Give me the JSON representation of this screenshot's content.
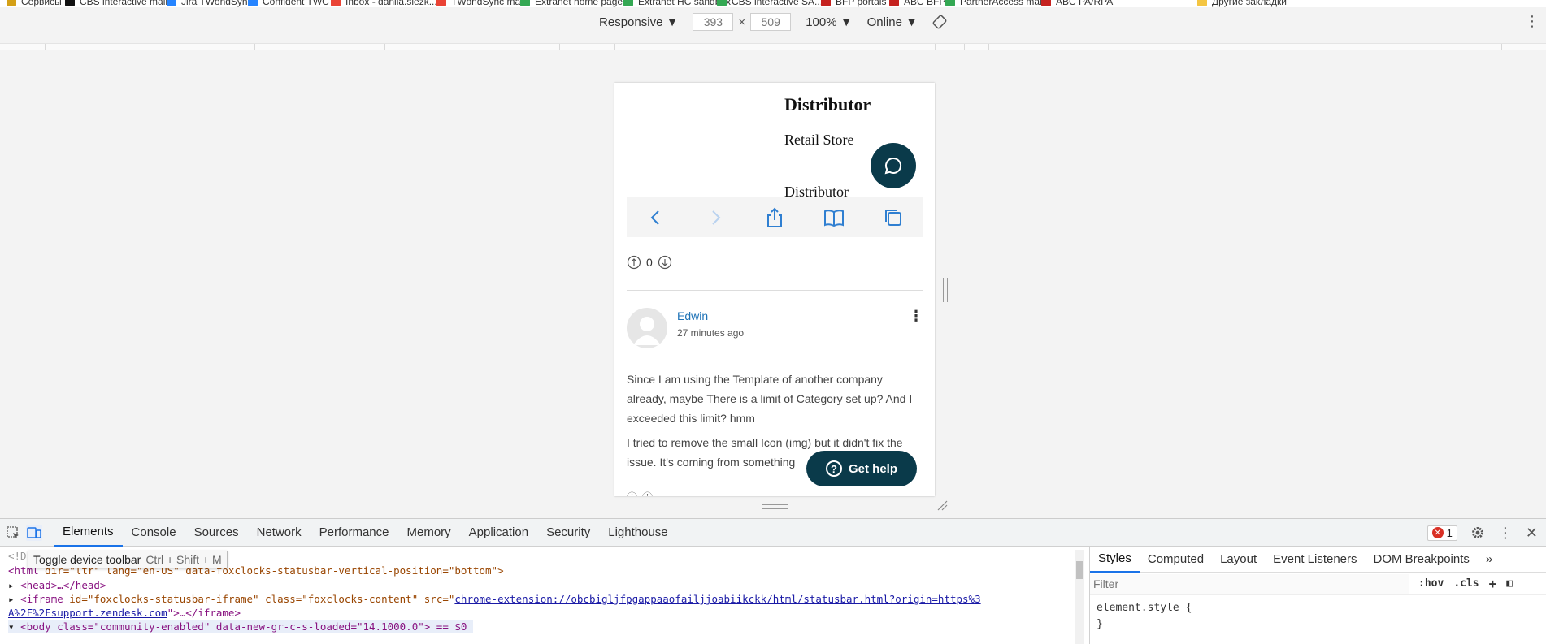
{
  "bookmarks": [
    {
      "label": "Сервисы",
      "color": "#d4a017"
    },
    {
      "label": "CBS interactive main",
      "color": "#111111"
    },
    {
      "label": "Jira TWondSync",
      "color": "#2684ff"
    },
    {
      "label": "Confident TWC",
      "color": "#2684ff"
    },
    {
      "label": "Inbox - danila.slezk...",
      "color": "#ea4335"
    },
    {
      "label": "TWondSync mail",
      "color": "#ea4335"
    },
    {
      "label": "Extranet home page",
      "color": "#34a853"
    },
    {
      "label": "Extranet HC sandbox",
      "color": "#34a853"
    },
    {
      "label": "CBS interactive SA...",
      "color": "#34a853"
    },
    {
      "label": "BFP portals",
      "color": "#c5221f"
    },
    {
      "label": "ABC BFP",
      "color": "#c5221f"
    },
    {
      "label": "PartnerAccess main",
      "color": "#34a853"
    },
    {
      "label": "ABC PA/RPA",
      "color": "#c5221f"
    },
    {
      "label": "Другие закладки",
      "color": "#f4c542"
    }
  ],
  "device_toolbar": {
    "device": "Responsive ▼",
    "width": "393",
    "height": "509",
    "zoom": "100% ▼",
    "network": "Online ▼",
    "times": "×"
  },
  "phone": {
    "menu_title": "Distributor",
    "menu_item_1": "Retail Store",
    "menu_item_2": "Distributor",
    "vote_count": "0",
    "author": "Edwin",
    "timestamp": "27 minutes ago",
    "paragraph_1": "Since I am using the Template of another company already, maybe There is a limit of Category set up? And I exceeded this limit? hmm",
    "paragraph_2": "I tried to remove the small Icon (img) but it didn't fix the issue. It's coming from something",
    "get_help": "Get help",
    "accent_color": "#0a3a4a",
    "link_color": "#1f73b7"
  },
  "devtools": {
    "tabs": [
      "Elements",
      "Console",
      "Sources",
      "Network",
      "Performance",
      "Memory",
      "Application",
      "Security",
      "Lighthouse"
    ],
    "active_tab": "Elements",
    "error_count": "1",
    "tooltip": "Toggle device toolbar",
    "tooltip_shortcut": "Ctrl + Shift + M",
    "dom": {
      "line0": "<!D",
      "line1_tag": "<html",
      "line1_attrs": " dir=\"ltr\" lang=\"en-US\" data-foxclocks-statusbar-vertical-position=\"bottom\">",
      "line2": "<head>…</head>",
      "line3_tag": "<iframe",
      "line3_attrs": " id=\"foxclocks-statusbar-iframe\" class=\"foxclocks-content\" src=\"",
      "line3_link": "chrome-extension://obcbigljfpgappaaofailjjoabiikckk/html/statusbar.html?origin=https%3",
      "line4_link": "A%2F%2Fsupport.zendesk.com",
      "line4_rest": "\">…</iframe>",
      "line5": "<body class=\"community-enabled\" data-new-gr-c-s-loaded=\"14.1000.0\"> == $0"
    },
    "styles_tabs": [
      "Styles",
      "Computed",
      "Layout",
      "Event Listeners",
      "DOM Breakpoints"
    ],
    "styles_active": "Styles",
    "filter_placeholder": "Filter",
    "hov": ":hov",
    "cls": ".cls",
    "more_tabs": "»",
    "style_rule_open": "element.style {",
    "style_rule_close": "}"
  }
}
